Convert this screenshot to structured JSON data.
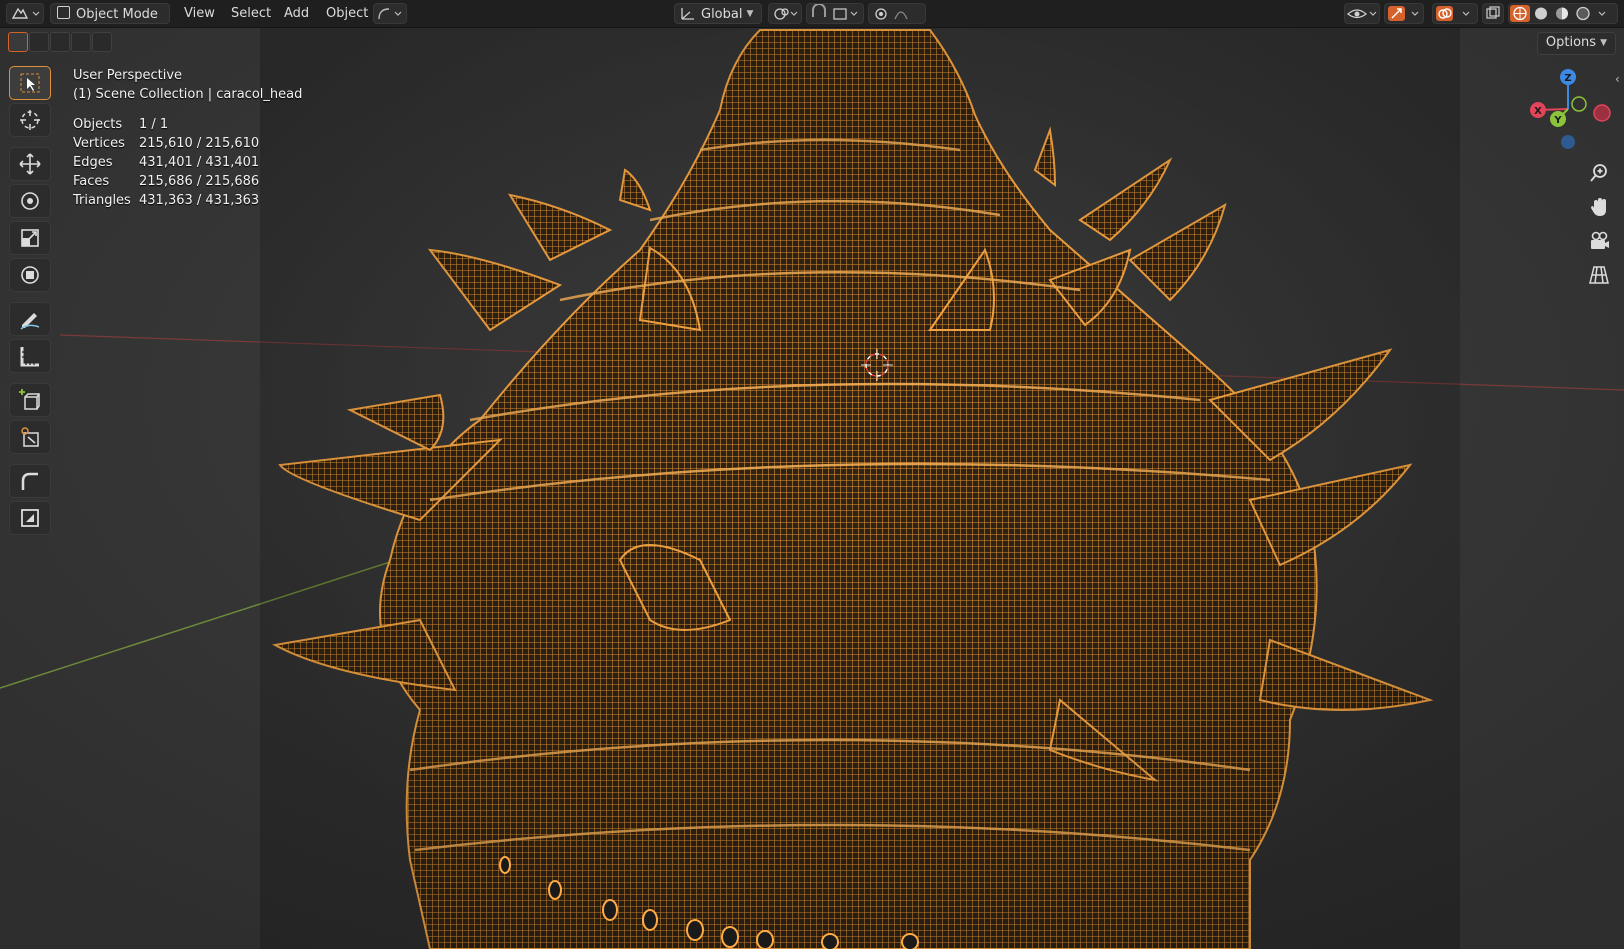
{
  "header": {
    "mode_label": "Object Mode",
    "menus": [
      "View",
      "Select",
      "Add",
      "Object"
    ],
    "transform_orientation": "Global",
    "options_label": "Options"
  },
  "overlay": {
    "view_name": "User Perspective",
    "collection": "(1) Scene Collection | caracol_head",
    "stats": [
      {
        "label": "Objects",
        "value": "1 / 1"
      },
      {
        "label": "Vertices",
        "value": "215,610 / 215,610"
      },
      {
        "label": "Edges",
        "value": "431,401 / 431,401"
      },
      {
        "label": "Faces",
        "value": "215,686 / 215,686"
      },
      {
        "label": "Triangles",
        "value": "431,363 / 431,363"
      }
    ]
  },
  "gizmo": {
    "z": "Z",
    "y": "Y",
    "x": "X"
  },
  "colors": {
    "wire": "#ff9a2e",
    "accent": "#e08f3a",
    "axis_x": "#e2445a",
    "axis_y": "#8bc43a",
    "axis_z": "#3d8ae5"
  },
  "tools": [
    "select-box-icon",
    "cursor-icon",
    "move-icon",
    "rotate-icon",
    "scale-icon",
    "transform-icon",
    "annotate-icon",
    "measure-icon",
    "add-cube-icon",
    "object-tool-icon",
    "bevel-icon",
    "extra-icon"
  ]
}
